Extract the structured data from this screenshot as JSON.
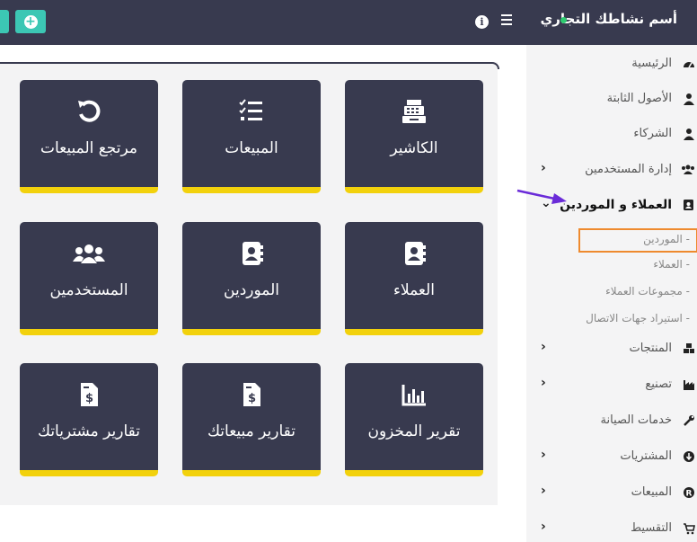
{
  "app": {
    "business_name": "أسم نشاطك التجاري",
    "online_color": "#2ecc71"
  },
  "colors": {
    "topbar": "#383a4f",
    "accent_green": "#3cc7b4",
    "tile_bar": "#f2d10c",
    "highlight": "#ee8a2e"
  },
  "topbar": {
    "add_icon": "plus-circle-icon",
    "info_icon": "info-icon",
    "menu_icon": "hamburger-icon"
  },
  "sidebar": {
    "items": [
      {
        "label": "الرئيسية",
        "icon": "dashboard-icon",
        "chevron": false
      },
      {
        "label": "الأصول الثابتة",
        "icon": "user-icon",
        "chevron": false
      },
      {
        "label": "الشركاء",
        "icon": "user-icon",
        "chevron": false
      },
      {
        "label": "إدارة المستخدمين",
        "icon": "users-icon",
        "chevron": true
      },
      {
        "label": "العملاء و الموردين",
        "icon": "address-book-icon",
        "chevron": true,
        "active": true
      },
      {
        "label": "المنتجات",
        "icon": "cubes-icon",
        "chevron": true
      },
      {
        "label": "تصنيع",
        "icon": "industry-icon",
        "chevron": true
      },
      {
        "label": "خدمات الصيانة",
        "icon": "wrench-icon",
        "chevron": false
      },
      {
        "label": "المشتريات",
        "icon": "download-circle-icon",
        "chevron": true
      },
      {
        "label": "المبيعات",
        "icon": "registered-icon",
        "chevron": true
      },
      {
        "label": "التقسيط",
        "icon": "cart-plus-icon",
        "chevron": true
      }
    ],
    "subitems": [
      {
        "label": "- الموردين"
      },
      {
        "label": "- العملاء"
      },
      {
        "label": "- مجموعات العملاء"
      },
      {
        "label": "- استيراد جهات الاتصال"
      }
    ]
  },
  "tiles": [
    {
      "label": "الكاشير",
      "icon": "cash-register-icon"
    },
    {
      "label": "المبيعات",
      "icon": "tasks-icon"
    },
    {
      "label": "مرتجع المبيعات",
      "icon": "undo-icon"
    },
    {
      "label": "العملاء",
      "icon": "address-book-icon"
    },
    {
      "label": "الموردين",
      "icon": "address-book-icon"
    },
    {
      "label": "المستخدمين",
      "icon": "users-icon"
    },
    {
      "label": "تقرير المخزون",
      "icon": "chart-bar-icon"
    },
    {
      "label": "تقارير مبيعاتك",
      "icon": "file-invoice-dollar-icon"
    },
    {
      "label": "تقارير مشترياتك",
      "icon": "file-invoice-dollar-icon"
    }
  ]
}
